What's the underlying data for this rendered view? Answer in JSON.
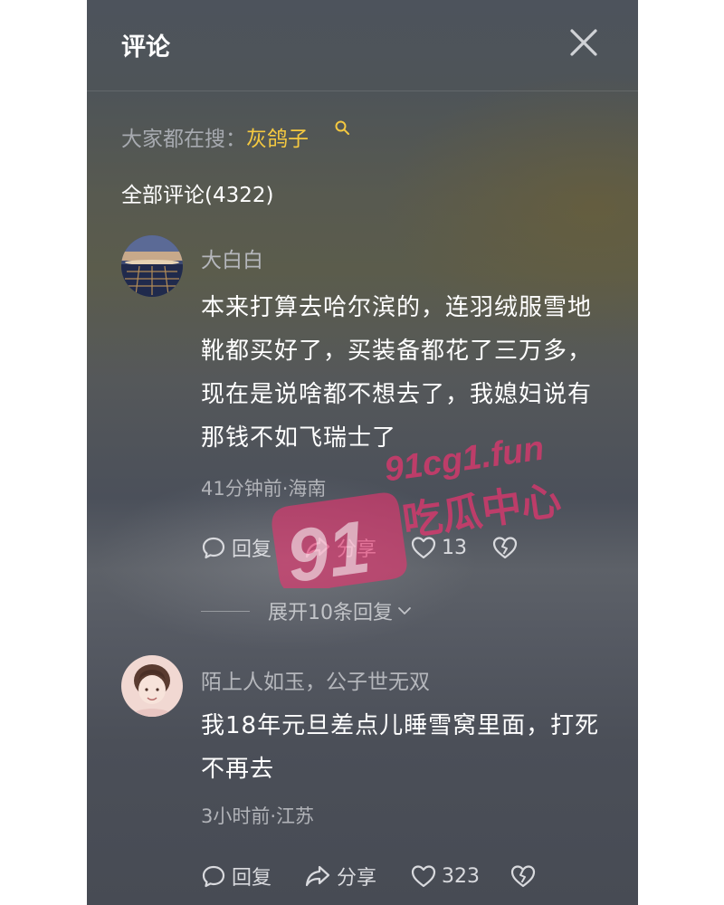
{
  "header": {
    "title": "评论"
  },
  "search": {
    "label": "大家都在搜：",
    "term": "灰鸽子"
  },
  "all_comments": {
    "label": "全部评论(4322)"
  },
  "comments": [
    {
      "username": "大白白",
      "text": "本来打算去哈尔滨的，连羽绒服雪地靴都买好了，买装备都花了三万多，现在是说啥都不想去了，我媳妇说有那钱不如飞瑞士了",
      "meta": "41分钟前·海南",
      "reply_label": "回复",
      "share_label": "分享",
      "likes": "13"
    },
    {
      "username": "陌上人如玉，公子世无双",
      "text": "我18年元旦差点儿睡雪窝里面，打死不再去",
      "meta": "3小时前·江苏",
      "reply_label": "回复",
      "share_label": "分享",
      "likes": "323"
    }
  ],
  "expand": {
    "label": "展开10条回复"
  },
  "watermark": {
    "number": "91",
    "site": "91cg1.fun",
    "name": "吃瓜中心"
  },
  "colors": {
    "accent": "#f5c940",
    "watermark": "#e8356f"
  }
}
